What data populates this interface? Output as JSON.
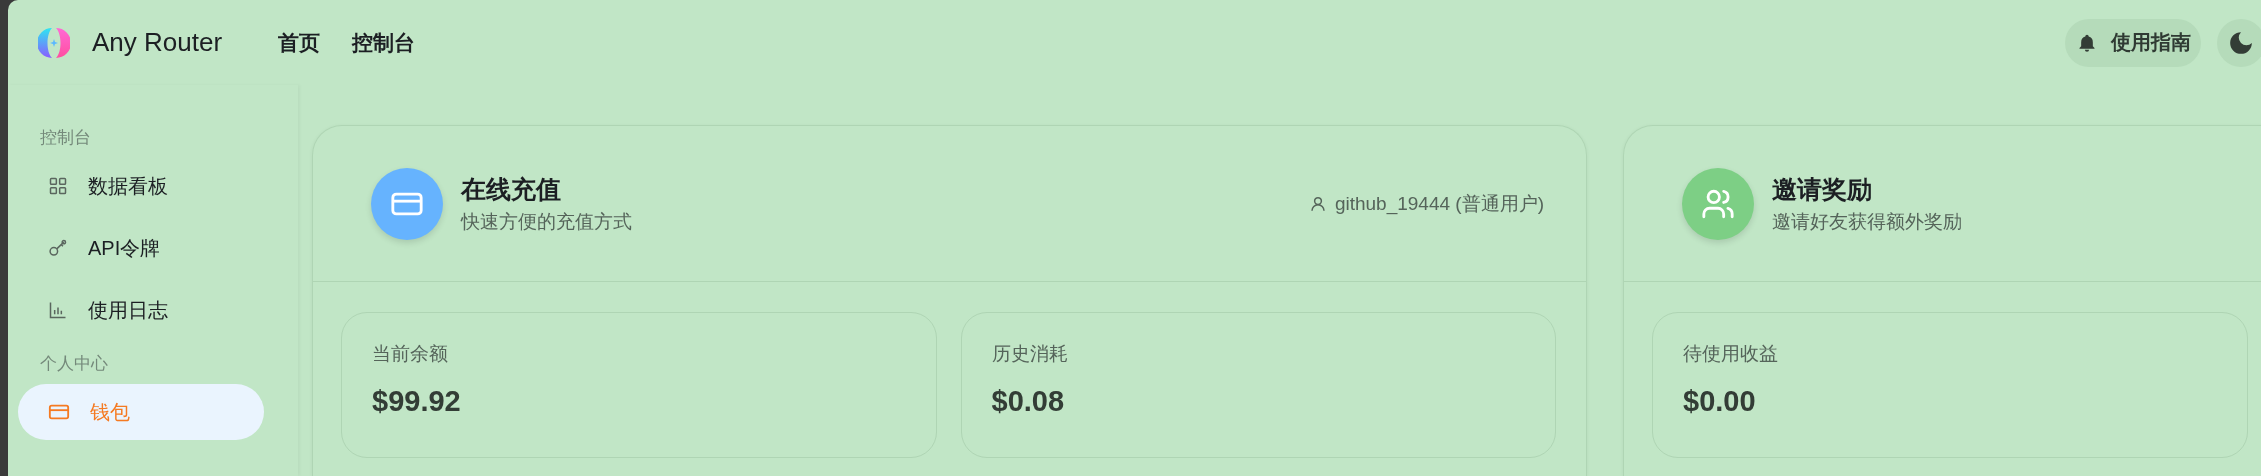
{
  "header": {
    "brand": "Any Router",
    "nav": [
      {
        "label": "首页"
      },
      {
        "label": "控制台"
      }
    ],
    "guide_button": "使用指南"
  },
  "sidebar": {
    "sections": [
      {
        "title": "控制台",
        "items": [
          {
            "label": "数据看板",
            "selected": false
          },
          {
            "label": "API令牌",
            "selected": false
          },
          {
            "label": "使用日志",
            "selected": false
          }
        ]
      },
      {
        "title": "个人中心",
        "items": [
          {
            "label": "钱包",
            "selected": true
          }
        ]
      }
    ]
  },
  "cards": [
    {
      "title": "在线充值",
      "subtitle": "快速方便的充值方式",
      "color": "#66b3fe",
      "user": "github_19444 (普通用户)",
      "stats": [
        {
          "label": "当前余额",
          "value": "$99.92"
        },
        {
          "label": "历史消耗",
          "value": "$0.08"
        }
      ]
    },
    {
      "title": "邀请奖励",
      "subtitle": "邀请好友获得额外奖励",
      "color": "#7dcf85",
      "stats": [
        {
          "label": "待使用收益",
          "value": "$0.00"
        }
      ]
    }
  ]
}
